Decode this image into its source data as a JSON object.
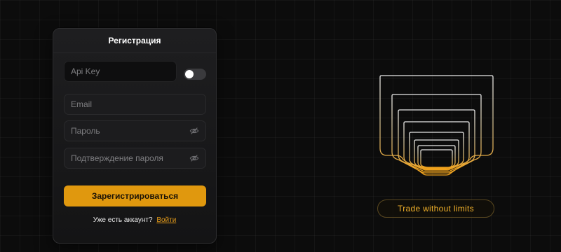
{
  "form": {
    "title": "Регистрация",
    "api_key_placeholder": "Api Key",
    "api_key_toggle_on": false,
    "email_placeholder": "Email",
    "password_placeholder": "Пароль",
    "confirm_placeholder": "Подтверждение пароля",
    "submit_label": "Зарегистрироваться",
    "have_account_text": "Уже есть аккаунт?",
    "login_link": "Войти"
  },
  "brand": {
    "tagline": "Trade without limits",
    "accent_color": "#e0980e"
  }
}
